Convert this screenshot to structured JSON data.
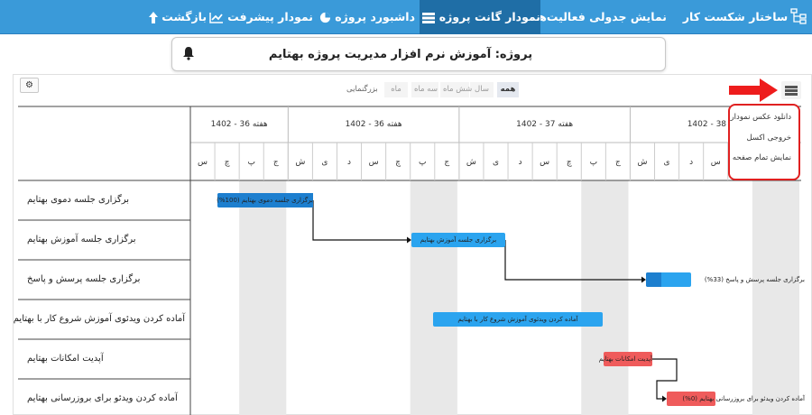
{
  "nav": {
    "items": [
      {
        "label": "ساختار شکست کار",
        "icon": "sitemap-icon"
      },
      {
        "label": "نمایش جدولی فعالیت‌ها",
        "icon": "table-icon"
      },
      {
        "label": "نمودار گانت پروژه",
        "icon": "gantt-icon",
        "active": true
      },
      {
        "label": "داشبورد پروژه",
        "icon": "pie-chart-icon"
      },
      {
        "label": "نمودار پیشرفت",
        "icon": "line-chart-icon"
      },
      {
        "label": "بازگشت",
        "icon": "arrow-up-icon"
      }
    ]
  },
  "project": {
    "title": "پروژه: آموزش نرم افزار مدیریت پروژه بهتایم"
  },
  "zoom": {
    "label": "بزرگنمایی",
    "options": [
      "همه",
      "سال",
      "شش ماه",
      "سه ماه",
      "ماه"
    ],
    "selected": "همه"
  },
  "export_menu": {
    "items": [
      "دانلود عکس نمودار",
      "خروجی اکسل",
      "نمایش تمام صفحه"
    ]
  },
  "timeline": {
    "weeks": [
      "هفته 36 - 1402",
      "هفته 36 - 1402",
      "هفته 37 - 1402",
      "هفته 38 - 1402"
    ],
    "days": [
      "س",
      "چ",
      "پ",
      "ج",
      "ش",
      "ی",
      "د",
      "س",
      "چ",
      "پ",
      "ج",
      "ش",
      "ی",
      "د",
      "س",
      "چ",
      "پ",
      "ج",
      "ش",
      "ی",
      "د",
      "س",
      "چ",
      "پ",
      "ج"
    ]
  },
  "tasks": [
    {
      "name": "برگزاری جلسه دموی بهتایم",
      "bar_label": "برگزاری جلسه دموی بهتایم",
      "percent_label": "(100%)",
      "progress": 1.0,
      "color": "#2ba4ef"
    },
    {
      "name": "برگزاری جلسه آموزش بهتایم",
      "bar_label": "برگزاری جلسه آموزش بهتایم",
      "percent_label": "",
      "progress": 0,
      "color": "#2ba4ef"
    },
    {
      "name": "برگزاری جلسه پرسش و پاسخ",
      "bar_label": "برگزاری جلسه پرسش و پاسخ",
      "percent_label": "(33%)",
      "progress": 0.33,
      "color": "#2ba4ef"
    },
    {
      "name": "آماده کردن ویدئوی آموزش شروع کار با بهتایم",
      "bar_label": "آماده کردن ویدئوی آموزش شروع کار با بهتایم",
      "percent_label": "",
      "progress": 0,
      "color": "#2ba4ef"
    },
    {
      "name": "آپدیت امکانات بهتایم",
      "bar_label": "آپدیت امکانات بهتایم",
      "percent_label": "",
      "progress": 0,
      "color": "#ef5b5b"
    },
    {
      "name": "آماده کردن ویدئو برای بروزرسانی بهتایم",
      "bar_label": "آماده کردن ویدئو برای بروزرسانی بهتایم",
      "percent_label": "(0%)",
      "progress": 0,
      "color": "#ef5b5b"
    }
  ]
}
